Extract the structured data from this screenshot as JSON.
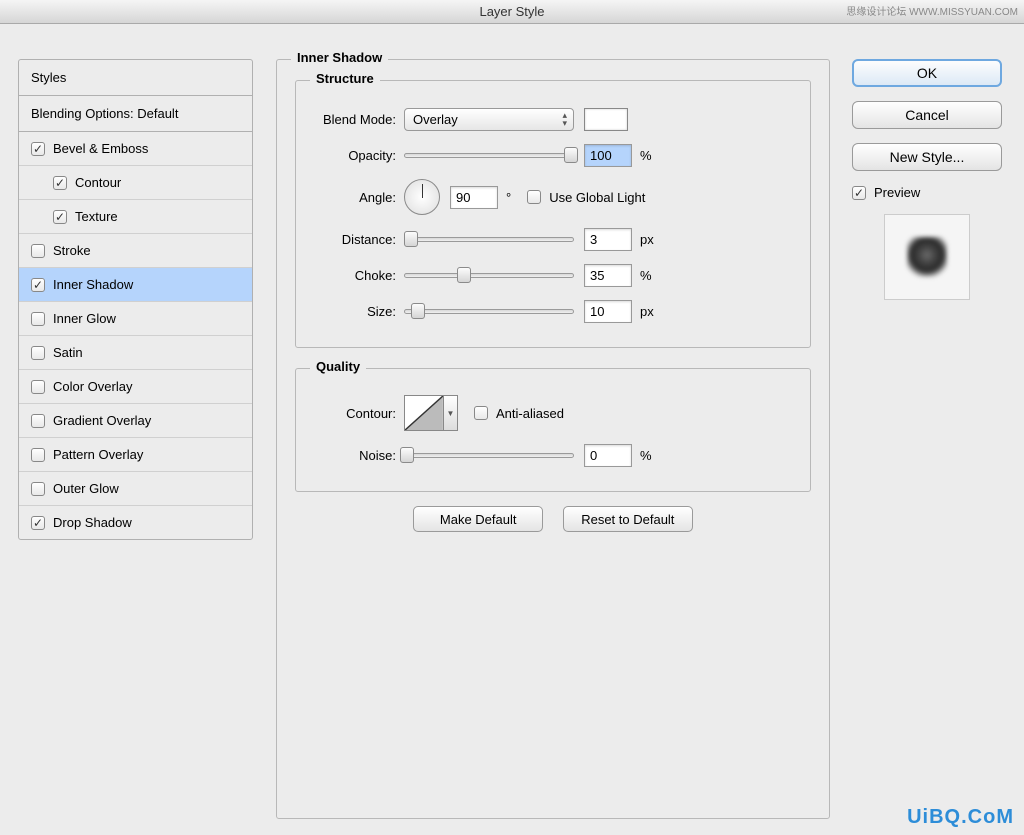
{
  "window_title": "Layer Style",
  "watermark_tr": "思缘设计论坛 WWW.MISSYUAN.COM",
  "watermark_br": "UiBQ.CoM",
  "sidebar": {
    "header": "Styles",
    "blending": "Blending Options: Default",
    "items": [
      {
        "label": "Bevel & Emboss",
        "checked": true,
        "indent": false
      },
      {
        "label": "Contour",
        "checked": true,
        "indent": true
      },
      {
        "label": "Texture",
        "checked": true,
        "indent": true
      },
      {
        "label": "Stroke",
        "checked": false,
        "indent": false
      },
      {
        "label": "Inner Shadow",
        "checked": true,
        "indent": false,
        "selected": true
      },
      {
        "label": "Inner Glow",
        "checked": false,
        "indent": false
      },
      {
        "label": "Satin",
        "checked": false,
        "indent": false
      },
      {
        "label": "Color Overlay",
        "checked": false,
        "indent": false
      },
      {
        "label": "Gradient Overlay",
        "checked": false,
        "indent": false
      },
      {
        "label": "Pattern Overlay",
        "checked": false,
        "indent": false
      },
      {
        "label": "Outer Glow",
        "checked": false,
        "indent": false
      },
      {
        "label": "Drop Shadow",
        "checked": true,
        "indent": false
      }
    ]
  },
  "main": {
    "title": "Inner Shadow",
    "structure": {
      "title": "Structure",
      "blend_mode_label": "Blend Mode:",
      "blend_mode_value": "Overlay",
      "opacity_label": "Opacity:",
      "opacity_value": "100",
      "opacity_unit": "%",
      "angle_label": "Angle:",
      "angle_value": "90",
      "angle_unit": "°",
      "global_light_label": "Use Global Light",
      "global_light_checked": false,
      "distance_label": "Distance:",
      "distance_value": "3",
      "distance_unit": "px",
      "choke_label": "Choke:",
      "choke_value": "35",
      "choke_unit": "%",
      "size_label": "Size:",
      "size_value": "10",
      "size_unit": "px"
    },
    "quality": {
      "title": "Quality",
      "contour_label": "Contour:",
      "antialiased_label": "Anti-aliased",
      "antialiased_checked": false,
      "noise_label": "Noise:",
      "noise_value": "0",
      "noise_unit": "%"
    },
    "make_default": "Make Default",
    "reset_default": "Reset to Default"
  },
  "right": {
    "ok": "OK",
    "cancel": "Cancel",
    "new_style": "New Style...",
    "preview_label": "Preview",
    "preview_checked": true
  }
}
